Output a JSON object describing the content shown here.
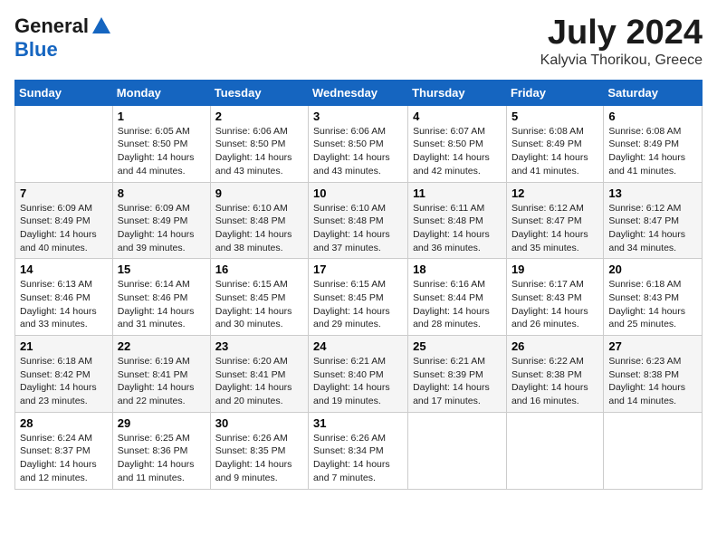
{
  "logo": {
    "general": "General",
    "blue": "Blue"
  },
  "title": {
    "month": "July 2024",
    "location": "Kalyvia Thorikou, Greece"
  },
  "columns": [
    "Sunday",
    "Monday",
    "Tuesday",
    "Wednesday",
    "Thursday",
    "Friday",
    "Saturday"
  ],
  "weeks": [
    [
      {
        "day": "",
        "sunrise": "",
        "sunset": "",
        "daylight": ""
      },
      {
        "day": "1",
        "sunrise": "Sunrise: 6:05 AM",
        "sunset": "Sunset: 8:50 PM",
        "daylight": "Daylight: 14 hours and 44 minutes."
      },
      {
        "day": "2",
        "sunrise": "Sunrise: 6:06 AM",
        "sunset": "Sunset: 8:50 PM",
        "daylight": "Daylight: 14 hours and 43 minutes."
      },
      {
        "day": "3",
        "sunrise": "Sunrise: 6:06 AM",
        "sunset": "Sunset: 8:50 PM",
        "daylight": "Daylight: 14 hours and 43 minutes."
      },
      {
        "day": "4",
        "sunrise": "Sunrise: 6:07 AM",
        "sunset": "Sunset: 8:50 PM",
        "daylight": "Daylight: 14 hours and 42 minutes."
      },
      {
        "day": "5",
        "sunrise": "Sunrise: 6:08 AM",
        "sunset": "Sunset: 8:49 PM",
        "daylight": "Daylight: 14 hours and 41 minutes."
      },
      {
        "day": "6",
        "sunrise": "Sunrise: 6:08 AM",
        "sunset": "Sunset: 8:49 PM",
        "daylight": "Daylight: 14 hours and 41 minutes."
      }
    ],
    [
      {
        "day": "7",
        "sunrise": "Sunrise: 6:09 AM",
        "sunset": "Sunset: 8:49 PM",
        "daylight": "Daylight: 14 hours and 40 minutes."
      },
      {
        "day": "8",
        "sunrise": "Sunrise: 6:09 AM",
        "sunset": "Sunset: 8:49 PM",
        "daylight": "Daylight: 14 hours and 39 minutes."
      },
      {
        "day": "9",
        "sunrise": "Sunrise: 6:10 AM",
        "sunset": "Sunset: 8:48 PM",
        "daylight": "Daylight: 14 hours and 38 minutes."
      },
      {
        "day": "10",
        "sunrise": "Sunrise: 6:10 AM",
        "sunset": "Sunset: 8:48 PM",
        "daylight": "Daylight: 14 hours and 37 minutes."
      },
      {
        "day": "11",
        "sunrise": "Sunrise: 6:11 AM",
        "sunset": "Sunset: 8:48 PM",
        "daylight": "Daylight: 14 hours and 36 minutes."
      },
      {
        "day": "12",
        "sunrise": "Sunrise: 6:12 AM",
        "sunset": "Sunset: 8:47 PM",
        "daylight": "Daylight: 14 hours and 35 minutes."
      },
      {
        "day": "13",
        "sunrise": "Sunrise: 6:12 AM",
        "sunset": "Sunset: 8:47 PM",
        "daylight": "Daylight: 14 hours and 34 minutes."
      }
    ],
    [
      {
        "day": "14",
        "sunrise": "Sunrise: 6:13 AM",
        "sunset": "Sunset: 8:46 PM",
        "daylight": "Daylight: 14 hours and 33 minutes."
      },
      {
        "day": "15",
        "sunrise": "Sunrise: 6:14 AM",
        "sunset": "Sunset: 8:46 PM",
        "daylight": "Daylight: 14 hours and 31 minutes."
      },
      {
        "day": "16",
        "sunrise": "Sunrise: 6:15 AM",
        "sunset": "Sunset: 8:45 PM",
        "daylight": "Daylight: 14 hours and 30 minutes."
      },
      {
        "day": "17",
        "sunrise": "Sunrise: 6:15 AM",
        "sunset": "Sunset: 8:45 PM",
        "daylight": "Daylight: 14 hours and 29 minutes."
      },
      {
        "day": "18",
        "sunrise": "Sunrise: 6:16 AM",
        "sunset": "Sunset: 8:44 PM",
        "daylight": "Daylight: 14 hours and 28 minutes."
      },
      {
        "day": "19",
        "sunrise": "Sunrise: 6:17 AM",
        "sunset": "Sunset: 8:43 PM",
        "daylight": "Daylight: 14 hours and 26 minutes."
      },
      {
        "day": "20",
        "sunrise": "Sunrise: 6:18 AM",
        "sunset": "Sunset: 8:43 PM",
        "daylight": "Daylight: 14 hours and 25 minutes."
      }
    ],
    [
      {
        "day": "21",
        "sunrise": "Sunrise: 6:18 AM",
        "sunset": "Sunset: 8:42 PM",
        "daylight": "Daylight: 14 hours and 23 minutes."
      },
      {
        "day": "22",
        "sunrise": "Sunrise: 6:19 AM",
        "sunset": "Sunset: 8:41 PM",
        "daylight": "Daylight: 14 hours and 22 minutes."
      },
      {
        "day": "23",
        "sunrise": "Sunrise: 6:20 AM",
        "sunset": "Sunset: 8:41 PM",
        "daylight": "Daylight: 14 hours and 20 minutes."
      },
      {
        "day": "24",
        "sunrise": "Sunrise: 6:21 AM",
        "sunset": "Sunset: 8:40 PM",
        "daylight": "Daylight: 14 hours and 19 minutes."
      },
      {
        "day": "25",
        "sunrise": "Sunrise: 6:21 AM",
        "sunset": "Sunset: 8:39 PM",
        "daylight": "Daylight: 14 hours and 17 minutes."
      },
      {
        "day": "26",
        "sunrise": "Sunrise: 6:22 AM",
        "sunset": "Sunset: 8:38 PM",
        "daylight": "Daylight: 14 hours and 16 minutes."
      },
      {
        "day": "27",
        "sunrise": "Sunrise: 6:23 AM",
        "sunset": "Sunset: 8:38 PM",
        "daylight": "Daylight: 14 hours and 14 minutes."
      }
    ],
    [
      {
        "day": "28",
        "sunrise": "Sunrise: 6:24 AM",
        "sunset": "Sunset: 8:37 PM",
        "daylight": "Daylight: 14 hours and 12 minutes."
      },
      {
        "day": "29",
        "sunrise": "Sunrise: 6:25 AM",
        "sunset": "Sunset: 8:36 PM",
        "daylight": "Daylight: 14 hours and 11 minutes."
      },
      {
        "day": "30",
        "sunrise": "Sunrise: 6:26 AM",
        "sunset": "Sunset: 8:35 PM",
        "daylight": "Daylight: 14 hours and 9 minutes."
      },
      {
        "day": "31",
        "sunrise": "Sunrise: 6:26 AM",
        "sunset": "Sunset: 8:34 PM",
        "daylight": "Daylight: 14 hours and 7 minutes."
      },
      {
        "day": "",
        "sunrise": "",
        "sunset": "",
        "daylight": ""
      },
      {
        "day": "",
        "sunrise": "",
        "sunset": "",
        "daylight": ""
      },
      {
        "day": "",
        "sunrise": "",
        "sunset": "",
        "daylight": ""
      }
    ]
  ]
}
